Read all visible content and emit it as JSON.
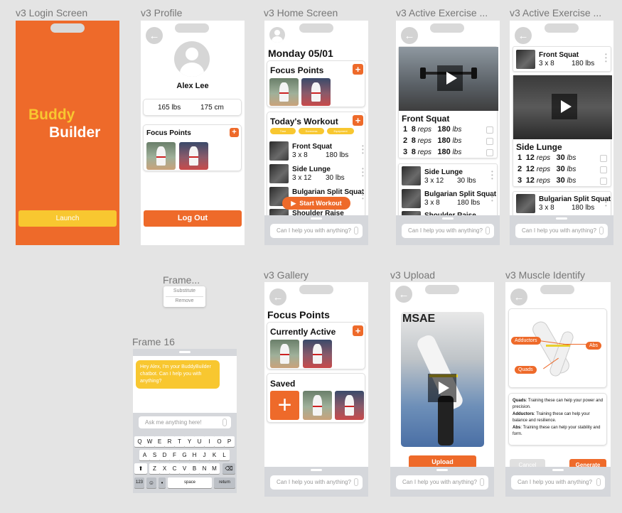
{
  "frames": {
    "login": "v3 Login Screen",
    "profile": "v3 Profile",
    "home": "v3 Home Screen",
    "active1": "v3 Active Exercise ...",
    "active2": "v3 Active Exercise ...",
    "frame": "Frame...",
    "frame16": "Frame 16",
    "gallery": "v3 Gallery",
    "upload": "v3 Upload",
    "muscle": "v3 Muscle Identify"
  },
  "login": {
    "title1": "Buddy",
    "title2": "Builder",
    "launch": "Launch"
  },
  "profile": {
    "name": "Alex Lee",
    "weight": "165 lbs",
    "height": "175 cm",
    "focus": "Focus Points",
    "logout": "Log Out",
    "plus": "+"
  },
  "home": {
    "date": "Monday 05/01",
    "focus": "Focus Points",
    "workout": "Today's Workout",
    "tags": [
      "Time",
      "Soreness",
      "Equipment"
    ],
    "exercises": [
      {
        "name": "Front Squat",
        "sets": "3 x 8",
        "weight": "180 lbs"
      },
      {
        "name": "Side Lunge",
        "sets": "3 x 12",
        "weight": "30 lbs"
      },
      {
        "name": "Bulgarian Split Squat",
        "sets": "",
        "weight": ""
      },
      {
        "name": "Shoulder Raise",
        "sets": "",
        "weight": ""
      }
    ],
    "start": "Start Workout",
    "plus": "+"
  },
  "active1": {
    "exercise": "Front Squat",
    "sets": [
      {
        "n": "1",
        "reps": "8",
        "w": "180"
      },
      {
        "n": "2",
        "reps": "8",
        "w": "180"
      },
      {
        "n": "3",
        "reps": "8",
        "w": "180"
      }
    ],
    "reps_unit": "reps",
    "w_unit": "lbs",
    "next": [
      {
        "name": "Side Lunge",
        "sets": "3 x 12",
        "weight": "30 lbs"
      },
      {
        "name": "Bulgarian Split Squat",
        "sets": "3 x 8",
        "weight": "180 lbs"
      }
    ],
    "peek": "Shoulder Raise"
  },
  "active2": {
    "top": {
      "name": "Front Squat",
      "sets": "3 x 8",
      "weight": "180 lbs"
    },
    "exercise": "Side Lunge",
    "sets": [
      {
        "n": "1",
        "reps": "12",
        "w": "30"
      },
      {
        "n": "2",
        "reps": "12",
        "w": "30"
      },
      {
        "n": "3",
        "reps": "12",
        "w": "30"
      }
    ],
    "reps_unit": "reps",
    "w_unit": "lbs",
    "next": {
      "name": "Bulgarian Split Squat",
      "sets": "3 x 8",
      "weight": "180 lbs"
    }
  },
  "chat": {
    "placeholder": "Can I help you with anything?"
  },
  "frame_menu": {
    "substitute": "Substitute",
    "remove": "Remove"
  },
  "frame16": {
    "message": "Hey Alex, I'm your BuddyBuilder chatbot. Can I help you with anything?",
    "placeholder": "Ask me anything here!",
    "row1": [
      "Q",
      "W",
      "E",
      "R",
      "T",
      "Y",
      "U",
      "I",
      "O",
      "P"
    ],
    "row2": [
      "A",
      "S",
      "D",
      "F",
      "G",
      "H",
      "J",
      "K",
      "L"
    ],
    "row3": [
      "Z",
      "X",
      "C",
      "V",
      "B",
      "N",
      "M"
    ],
    "k123": "123",
    "space": "space",
    "return": "return"
  },
  "gallery": {
    "title": "Focus Points",
    "active": "Currently Active",
    "saved": "Saved",
    "plus": "+"
  },
  "upload": {
    "button": "Upload",
    "watermark": "MSAE"
  },
  "muscle": {
    "labels": [
      "Adductors",
      "Abs",
      "Quads"
    ],
    "desc": [
      {
        "t": "Quads",
        "d": ": Training these can help your power and precision."
      },
      {
        "t": "Adductors",
        "d": ": Training these can help your balance and resilience."
      },
      {
        "t": "Abs",
        "d": ": Training these can help your stability and form."
      }
    ],
    "cancel": "Cancel",
    "generate": "Generate"
  },
  "colors": {
    "accent": "#EE6A2A",
    "yellow": "#F8C730"
  }
}
